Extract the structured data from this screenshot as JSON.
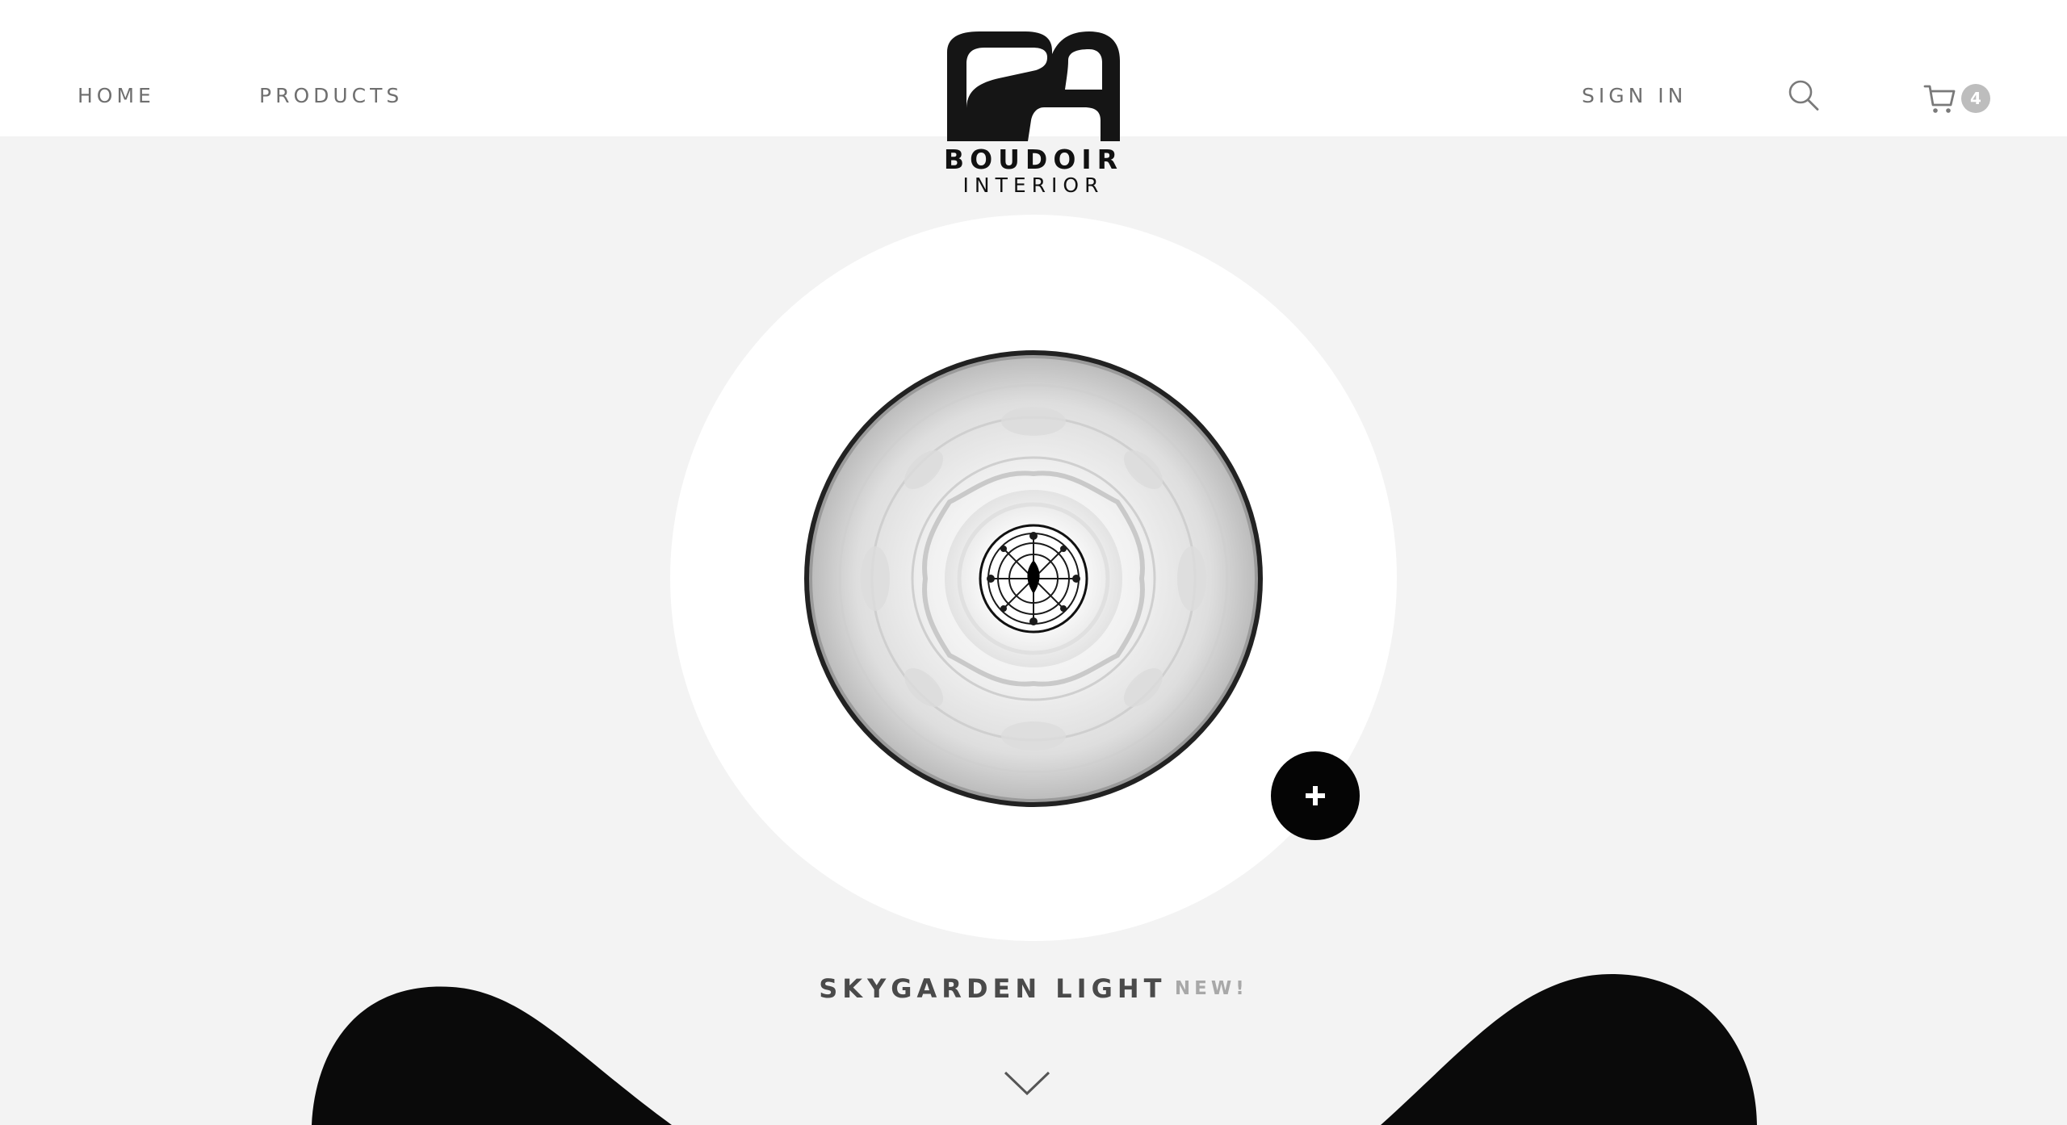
{
  "nav": {
    "home_label": "HOME",
    "products_label": "PRODUCTS",
    "signin_label": "SIGN IN"
  },
  "brand": {
    "name": "BOUDOIR",
    "subtitle": "INTERIOR",
    "logo_icon": "b-monogram-icon"
  },
  "header_icons": {
    "search": "search-icon",
    "cart": "shopping-cart-icon",
    "cart_count": "4"
  },
  "hero": {
    "product_name": "SKYGARDEN LIGHT",
    "product_tag": "NEW!",
    "add_button_icon": "plus-icon",
    "scroll_icon": "chevron-down-icon",
    "product_image": "skygarden-pendant-lamp-image"
  },
  "colors": {
    "header_bg": "#ffffff",
    "page_bg": "#f3f3f3",
    "accent": "#050505",
    "nav_text": "#6f6f6f",
    "badge": "#bdbdbd"
  }
}
